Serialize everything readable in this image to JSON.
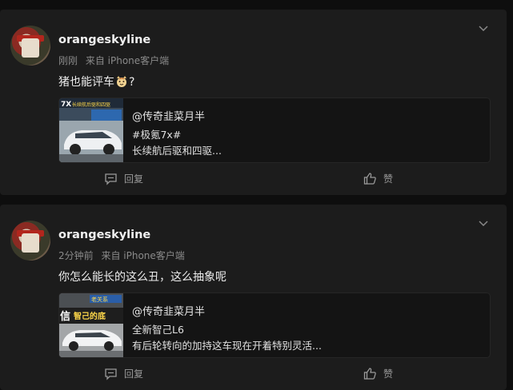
{
  "posts": [
    {
      "username": "orangeskyline",
      "time": "刚刚",
      "source": "来自 iPhone客户端",
      "content_before_emoji": "猪也能评车",
      "emoji": "cat-face-icon",
      "content_after_emoji": "?",
      "embed": {
        "author": "@传奇韭菜月半",
        "line1": "#极氪7x#",
        "line2": "长续航后驱和四驱...",
        "thumb_text": "7X 长续航后驱和四驱"
      },
      "reply_label": "回复",
      "like_label": "赞"
    },
    {
      "username": "orangeskyline",
      "time": "2分钟前",
      "source": "来自 iPhone客户端",
      "content": "你怎么能长的这么丑，这么抽象呢",
      "embed": {
        "author": "@传奇韭菜月半",
        "line1": "全新智己L6",
        "line2": "有后轮转向的加持这车现在开着特别灵活...",
        "thumb_text": "信智己的底"
      },
      "reply_label": "回复",
      "like_label": "赞"
    }
  ],
  "colors": {
    "background": "#0e0e0e",
    "card": "#1c1c1c",
    "embed_bg": "#141414",
    "muted_text": "#8a8a8a",
    "primary_text": "#ececec"
  }
}
